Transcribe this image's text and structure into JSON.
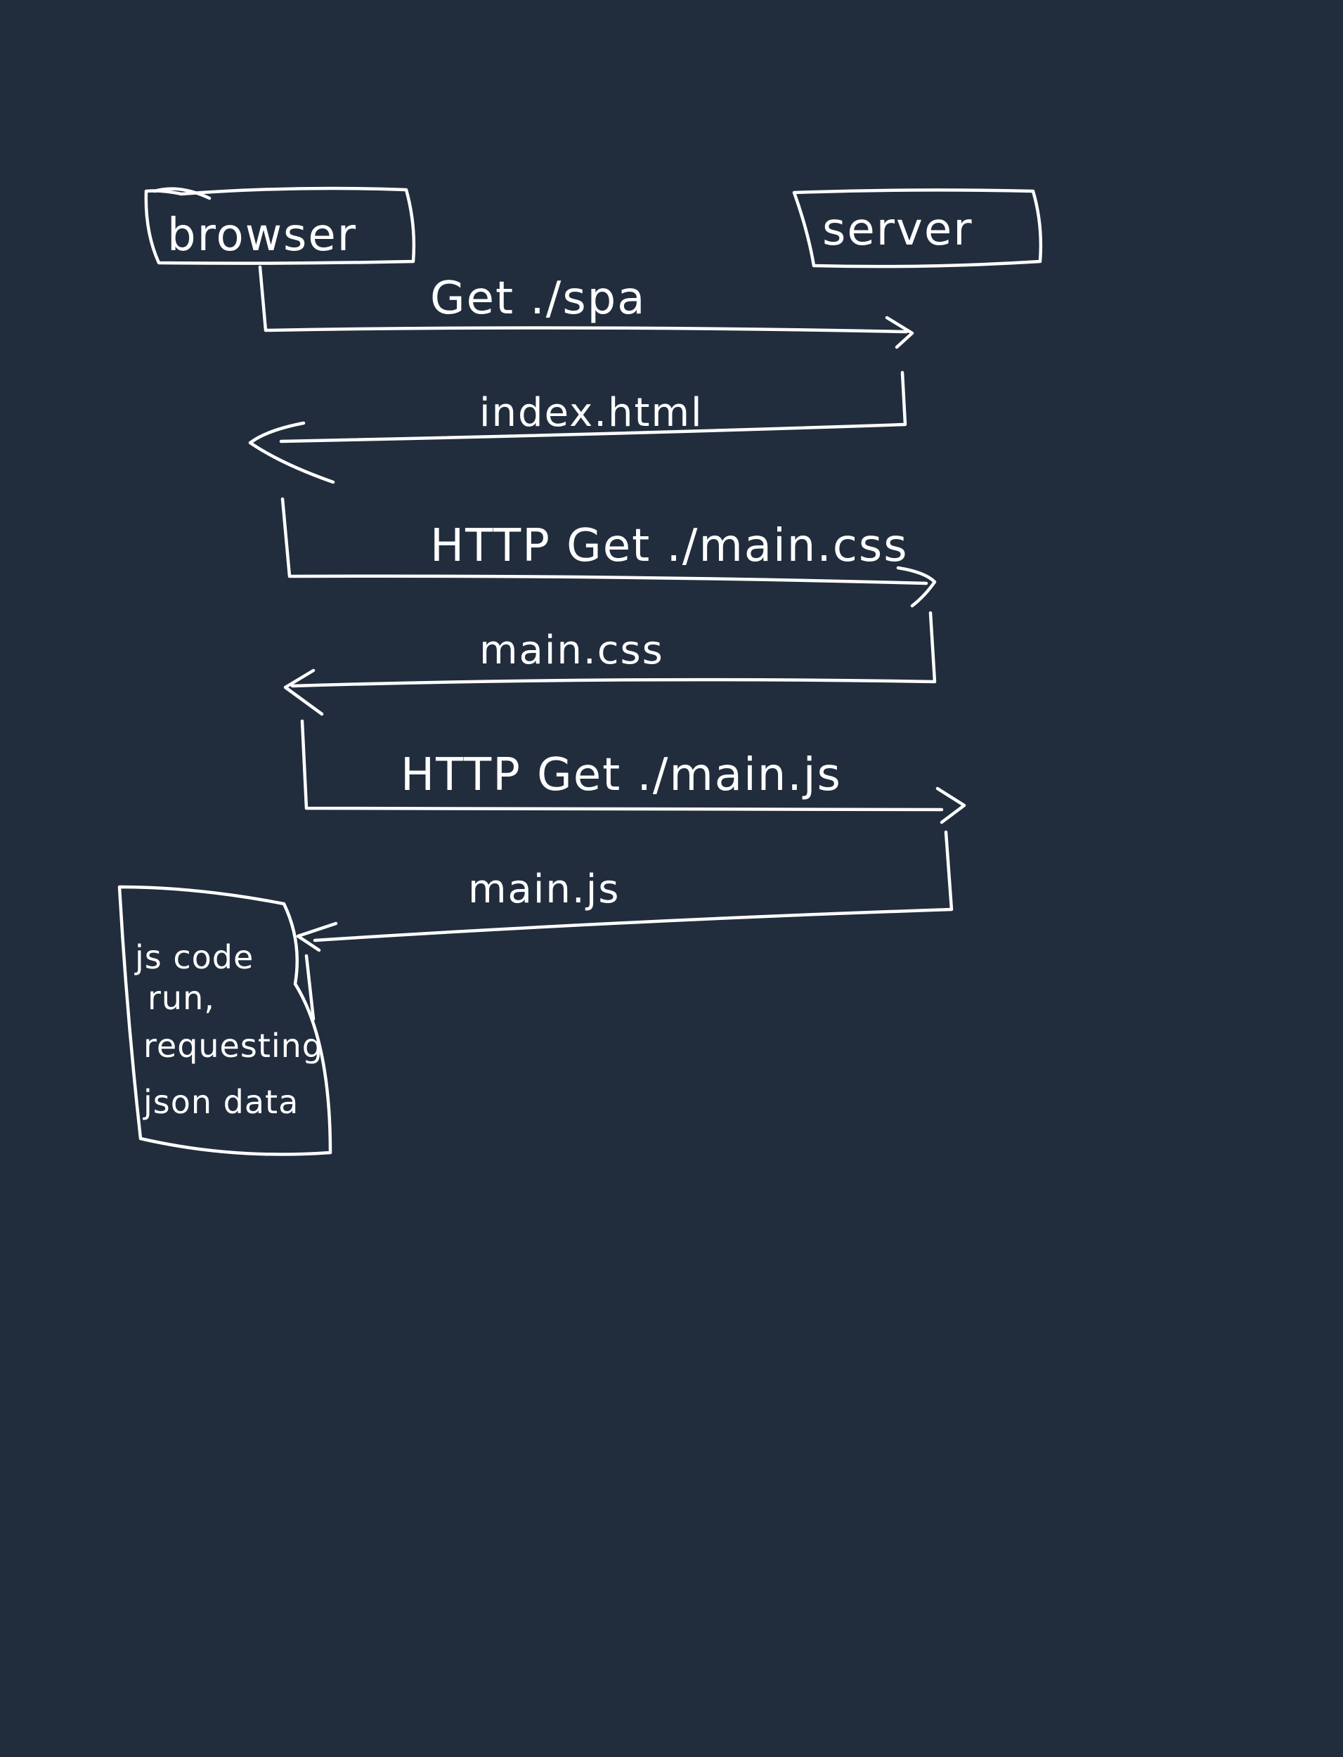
{
  "participants": {
    "browser": "browser",
    "server": "server"
  },
  "messages": [
    {
      "label": "Get ./spa",
      "direction": "browser-to-server"
    },
    {
      "label": "index.html",
      "direction": "server-to-browser"
    },
    {
      "label": "HTTP Get ./main.css",
      "direction": "browser-to-server"
    },
    {
      "label": "main.css",
      "direction": "server-to-browser"
    },
    {
      "label": "HTTP Get ./main.js",
      "direction": "browser-to-server"
    },
    {
      "label": "main.js",
      "direction": "server-to-browser"
    }
  ],
  "note": {
    "lines": [
      "js code",
      "run,",
      "requesting",
      "json data"
    ]
  },
  "colors": {
    "background": "#212d3d",
    "ink": "#ffffff"
  }
}
